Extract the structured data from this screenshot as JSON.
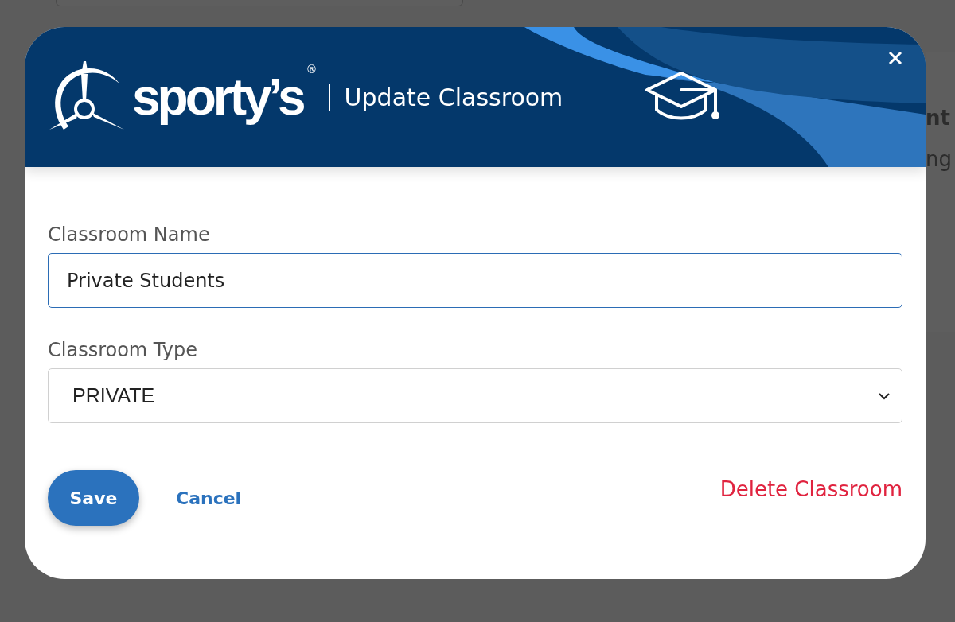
{
  "background": {
    "texts": [
      "nt",
      "ng"
    ]
  },
  "dialog": {
    "logo": {
      "wordmark": "sporty’s",
      "mark": "®"
    },
    "title": "Update Classroom",
    "fields": [
      {
        "kind": "text",
        "label": "Classroom Name",
        "value": "Private Students",
        "focused": true
      },
      {
        "kind": "select",
        "label": "Classroom Type",
        "value": "PRIVATE",
        "focused": false
      }
    ],
    "buttons": [
      {
        "kind": "primary",
        "label": "Save"
      },
      {
        "kind": "link",
        "label": "Cancel"
      },
      {
        "kind": "danger",
        "label": "Delete Classroom"
      }
    ]
  }
}
